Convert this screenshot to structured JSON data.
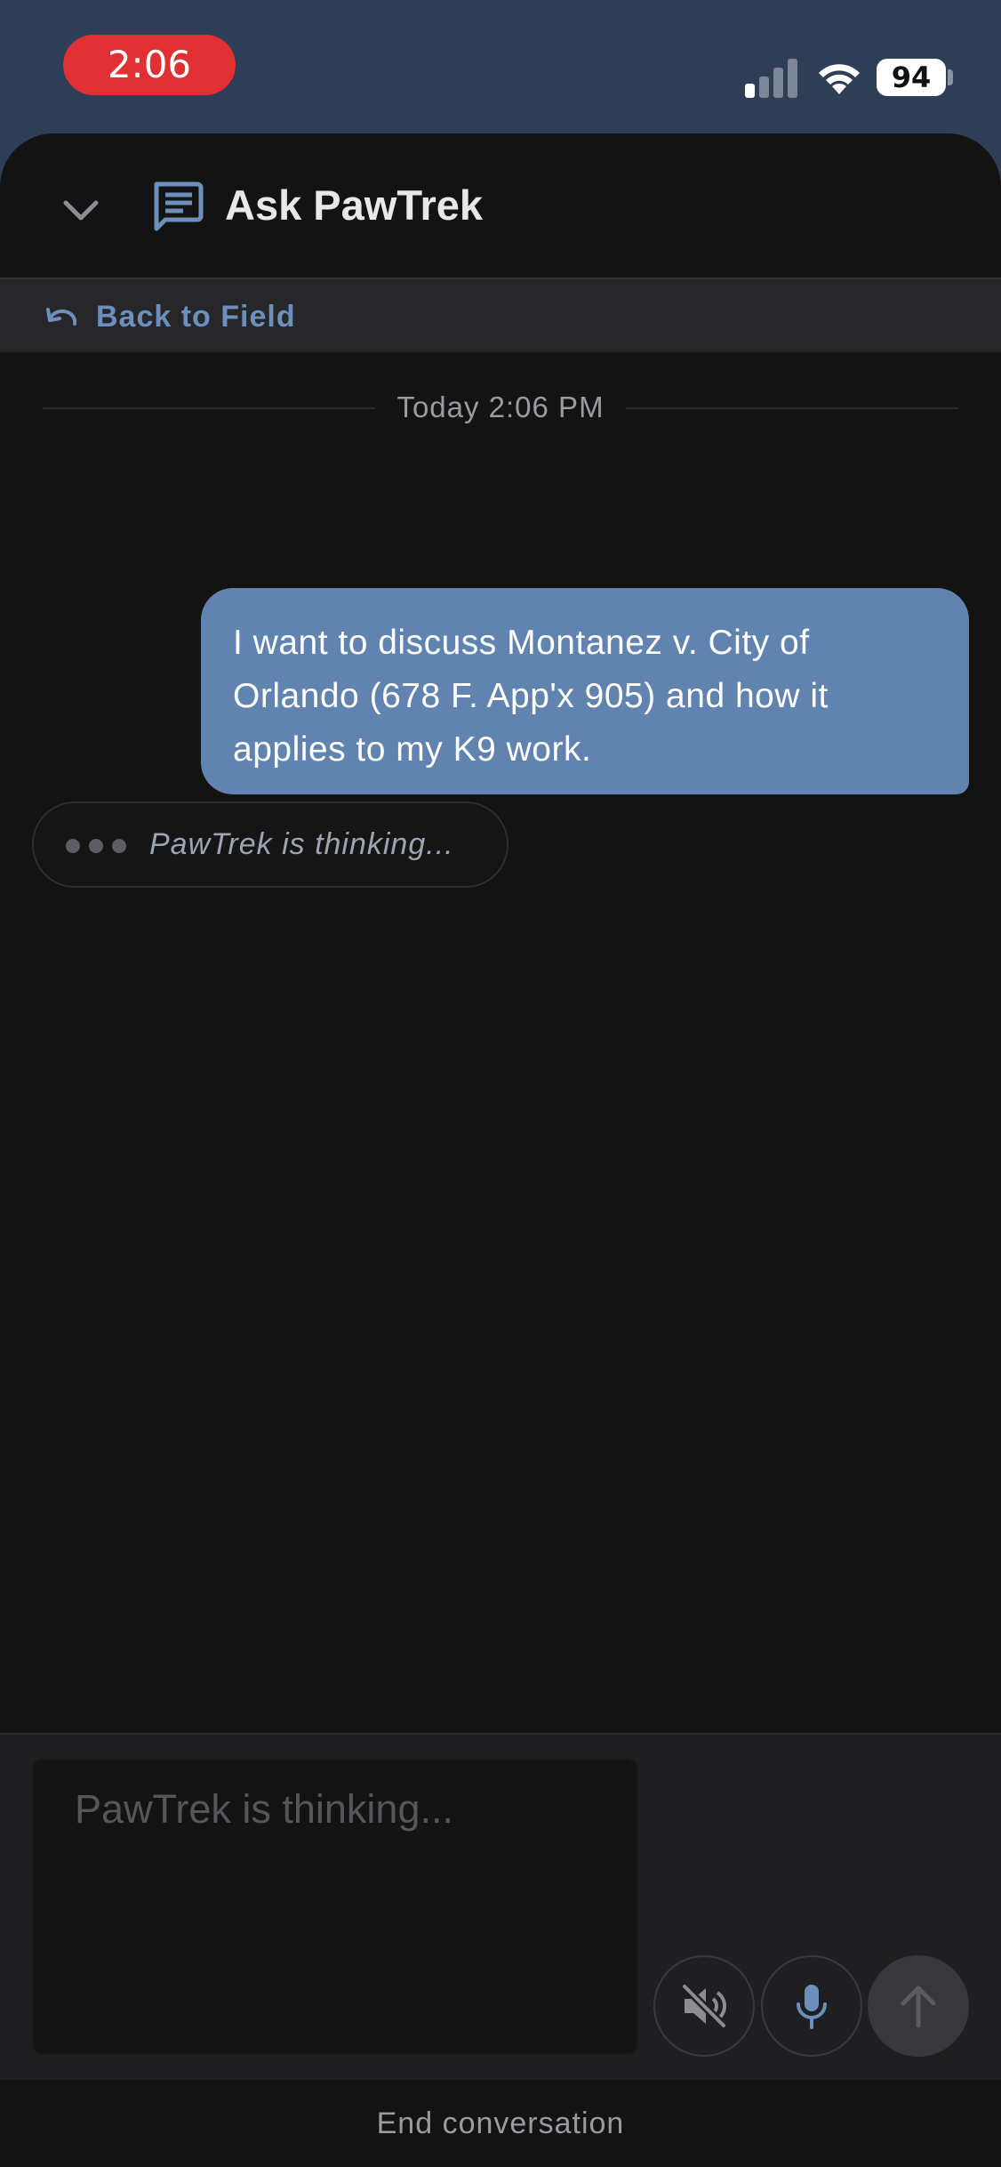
{
  "status_bar": {
    "time": "2:06",
    "battery": "94"
  },
  "header": {
    "title": "Ask PawTrek"
  },
  "back": {
    "label": "Back to Field"
  },
  "conversation": {
    "date_divider": "Today 2:06 PM",
    "user_message": "I want to discuss Montanez v. City of Orlando (678 F. App'x 905) and how it applies to my K9 work.",
    "thinking": "PawTrek is thinking..."
  },
  "composer": {
    "placeholder": "PawTrek is thinking..."
  },
  "footer": {
    "end_label": "End conversation"
  },
  "icons": {
    "collapse": "chevron-down-icon",
    "chat": "chat-icon",
    "back": "undo-icon",
    "mute": "speaker-muted-icon",
    "mic": "microphone-icon",
    "send": "arrow-up-icon"
  },
  "colors": {
    "accent": "#6183b0",
    "status_pill": "#e03034",
    "background": "#131314"
  }
}
